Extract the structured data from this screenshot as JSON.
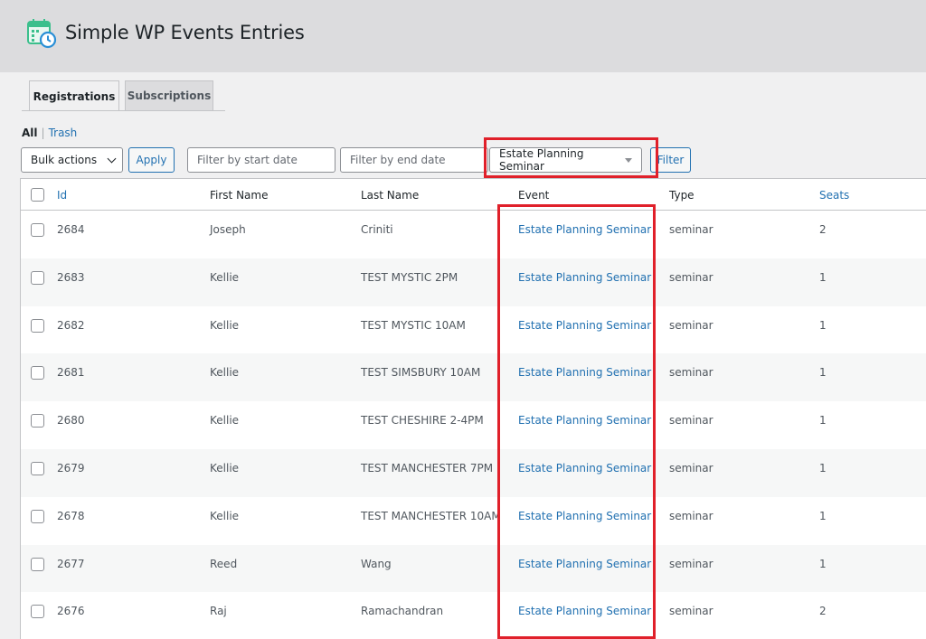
{
  "header": {
    "title": "Simple WP Events Entries",
    "icon": "calendar-clock-icon"
  },
  "tabs": [
    {
      "label": "Registrations",
      "active": true
    },
    {
      "label": "Subscriptions",
      "active": false
    }
  ],
  "views": {
    "all": "All",
    "separator": "|",
    "trash": "Trash"
  },
  "toolbar": {
    "bulk_actions": "Bulk actions",
    "apply": "Apply",
    "start_date_placeholder": "Filter by start date",
    "end_date_placeholder": "Filter by end date",
    "event_selected": "Estate Planning Seminar",
    "filter": "Filter"
  },
  "table": {
    "columns": [
      "Id",
      "First Name",
      "Last Name",
      "Event",
      "Type",
      "Seats"
    ],
    "rows": [
      {
        "id": "2684",
        "first": "Joseph",
        "last": "Criniti",
        "event": "Estate Planning Seminar",
        "type": "seminar",
        "seats": "2"
      },
      {
        "id": "2683",
        "first": "Kellie",
        "last": "TEST MYSTIC 2PM",
        "event": "Estate Planning Seminar",
        "type": "seminar",
        "seats": "1"
      },
      {
        "id": "2682",
        "first": "Kellie",
        "last": "TEST MYSTIC 10AM",
        "event": "Estate Planning Seminar",
        "type": "seminar",
        "seats": "1"
      },
      {
        "id": "2681",
        "first": "Kellie",
        "last": "TEST SIMSBURY 10AM",
        "event": "Estate Planning Seminar",
        "type": "seminar",
        "seats": "1"
      },
      {
        "id": "2680",
        "first": "Kellie",
        "last": "TEST CHESHIRE 2-4PM",
        "event": "Estate Planning Seminar",
        "type": "seminar",
        "seats": "1"
      },
      {
        "id": "2679",
        "first": "Kellie",
        "last": "TEST MANCHESTER 7PM",
        "event": "Estate Planning Seminar",
        "type": "seminar",
        "seats": "1"
      },
      {
        "id": "2678",
        "first": "Kellie",
        "last": "TEST MANCHESTER 10AM",
        "event": "Estate Planning Seminar",
        "type": "seminar",
        "seats": "1"
      },
      {
        "id": "2677",
        "first": "Reed",
        "last": "Wang",
        "event": "Estate Planning Seminar",
        "type": "seminar",
        "seats": "1"
      },
      {
        "id": "2676",
        "first": "Raj",
        "last": "Ramachandran",
        "event": "Estate Planning Seminar",
        "type": "seminar",
        "seats": "2"
      }
    ]
  },
  "colors": {
    "accent": "#2271b1",
    "highlight": "#e0202a"
  }
}
